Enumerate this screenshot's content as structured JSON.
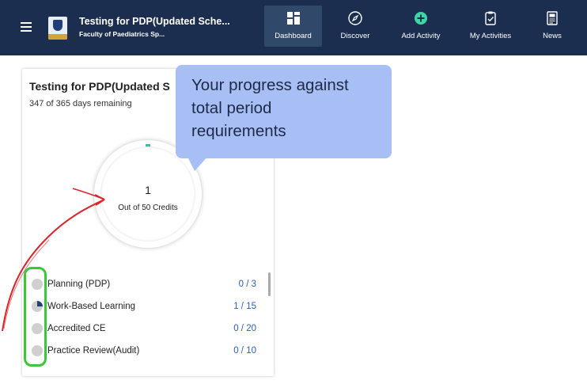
{
  "header": {
    "title": "Testing for PDP(Updated Sche...",
    "subtitle": "Faculty of Paediatrics Sp...",
    "logo_text": "Sandbox",
    "nav": [
      {
        "label": "Dashboard",
        "icon": "dashboard-icon",
        "active": true
      },
      {
        "label": "Discover",
        "icon": "compass-icon",
        "active": false
      },
      {
        "label": "Add Activity",
        "icon": "plus-circle-icon",
        "active": false
      },
      {
        "label": "My Activities",
        "icon": "clipboard-check-icon",
        "active": false
      },
      {
        "label": "News",
        "icon": "news-icon",
        "active": false
      }
    ],
    "colors": {
      "bar": "#1c2e4f",
      "active": "#30496a",
      "accent": "#3fd6a6"
    }
  },
  "card": {
    "title": "Testing for PDP(Updated S",
    "remaining": "347 of 365 days remaining",
    "progress": {
      "value": "1",
      "label": "Out of 50 Credits",
      "fraction": 0.02
    },
    "rows": [
      {
        "label": "Planning (PDP)",
        "value": "0 / 3",
        "progress": 0
      },
      {
        "label": "Work-Based Learning",
        "value": "1 / 15",
        "progress": 0.067
      },
      {
        "label": "Accredited CE",
        "value": "0 / 20",
        "progress": 0
      },
      {
        "label": "Practice Review(Audit)",
        "value": "0 / 10",
        "progress": 0
      }
    ]
  },
  "tooltip": {
    "lines": [
      "Your progress against",
      "total period",
      "requirements"
    ],
    "color": "#a8bff5"
  },
  "annotations": {
    "arrow_color": "#d9262b",
    "box_color": "#3cc63c"
  }
}
